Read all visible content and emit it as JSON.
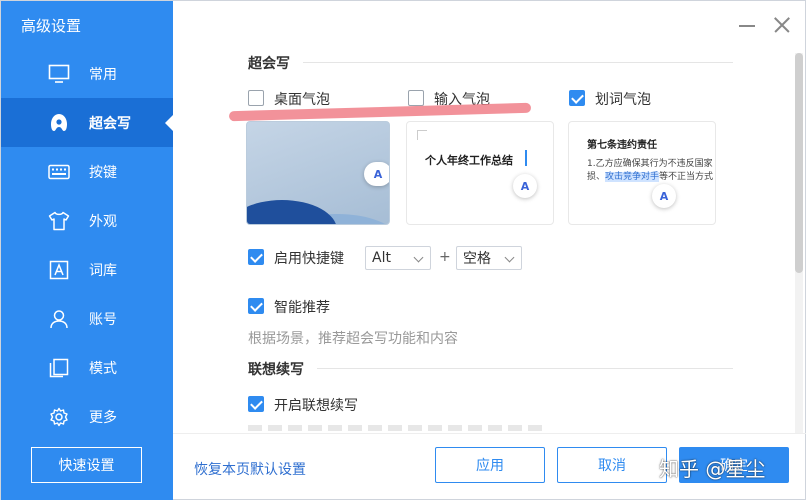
{
  "window": {
    "title": "高级设置",
    "minimize_icon": "minimize-icon",
    "close_icon": "close-icon"
  },
  "sidebar": {
    "items": [
      {
        "label": "常用",
        "icon": "monitor-icon"
      },
      {
        "label": "超会写",
        "icon": "ai-logo-icon"
      },
      {
        "label": "按键",
        "icon": "keyboard-icon"
      },
      {
        "label": "外观",
        "icon": "tshirt-icon"
      },
      {
        "label": "词库",
        "icon": "dictionary-icon"
      },
      {
        "label": "账号",
        "icon": "user-icon"
      },
      {
        "label": "模式",
        "icon": "mode-icon"
      },
      {
        "label": "更多",
        "icon": "gear-icon"
      }
    ],
    "active_index": 1,
    "quick_settings_label": "快速设置"
  },
  "main": {
    "section1": {
      "title": "超会写",
      "bubbles": [
        {
          "label": "桌面气泡",
          "checked": false
        },
        {
          "label": "输入气泡",
          "checked": false
        },
        {
          "label": "划词气泡",
          "checked": true
        }
      ],
      "previews": {
        "input_text": "个人年终工作总结",
        "word_title": "第七条违约责任",
        "word_line1": "1.乙方应确保其行为不违反国家",
        "word_line2_pre": "损、",
        "word_line2_highlight": "攻击竞争对手",
        "word_line2_post": "等不正当方式",
        "bubble_glyph": "A"
      },
      "hotkey": {
        "label": "启用快捷键",
        "checked": true,
        "key1": "Alt",
        "plus": "+",
        "key2": "空格"
      },
      "smart": {
        "label": "智能推荐",
        "checked": true,
        "hint": "根据场景，推荐超会写功能和内容"
      }
    },
    "section2": {
      "title": "联想续写",
      "continue": {
        "label": "开启联想续写",
        "checked": true
      }
    }
  },
  "footer": {
    "restore_label": "恢复本页默认设置",
    "apply_label": "应用",
    "cancel_label": "取消",
    "ok_label": "确定"
  },
  "watermark": "知乎 @星尘",
  "colors": {
    "accent": "#2f8bf0",
    "sidebar_active": "#1a6fd6",
    "link": "#2f6fd0"
  }
}
